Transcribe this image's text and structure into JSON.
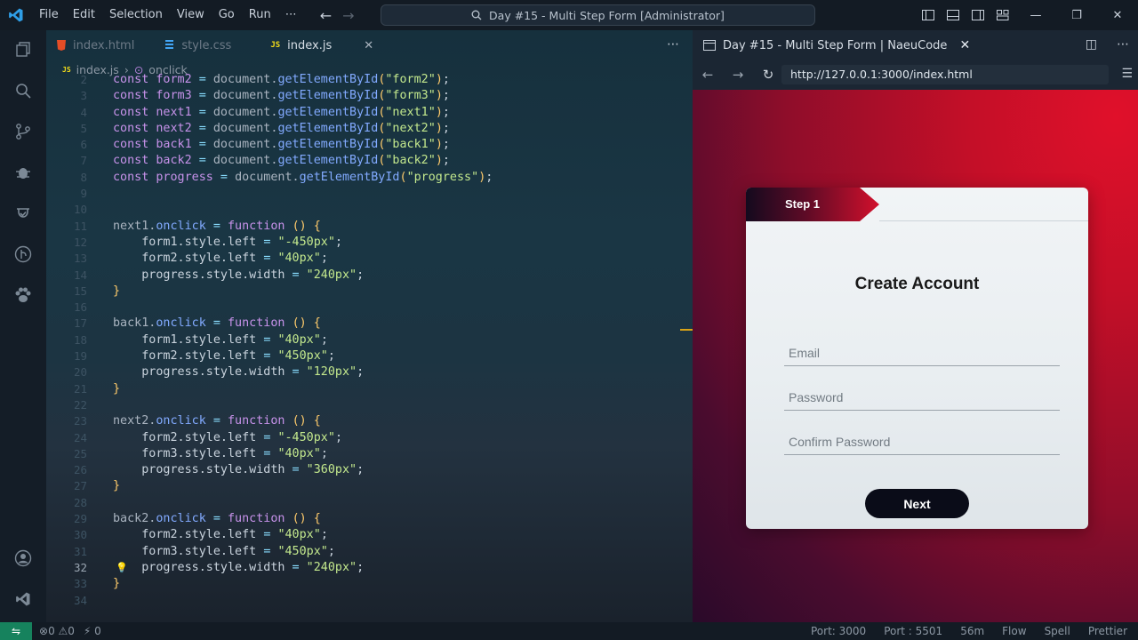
{
  "menu": [
    "File",
    "Edit",
    "Selection",
    "View",
    "Go",
    "Run",
    "⋯"
  ],
  "command_center": "Day #15 - Multi Step Form [Administrator]",
  "editor_tabs": [
    {
      "label": "index.html",
      "icon": "html-icon",
      "color": "#e44d26"
    },
    {
      "label": "style.css",
      "icon": "css-icon",
      "color": "#42a5f5"
    },
    {
      "label": "index.js",
      "icon": "js-icon",
      "color": "#f5de19",
      "active": true
    }
  ],
  "breadcrumb": {
    "file": "index.js",
    "symbol": "onclick"
  },
  "code_lines": [
    {
      "n": "2",
      "parts": [
        [
          "kw",
          "const "
        ],
        [
          "var",
          "form2"
        ],
        [
          "op",
          " = "
        ],
        [
          "obj",
          "document."
        ],
        [
          "fn",
          "getElementById"
        ],
        [
          "punc",
          "("
        ],
        [
          "str",
          "\"form2\""
        ],
        [
          "punc",
          ")"
        ],
        [
          "plain",
          ";"
        ]
      ]
    },
    {
      "n": "3",
      "parts": [
        [
          "kw",
          "const "
        ],
        [
          "var",
          "form3"
        ],
        [
          "op",
          " = "
        ],
        [
          "obj",
          "document."
        ],
        [
          "fn",
          "getElementById"
        ],
        [
          "punc",
          "("
        ],
        [
          "str",
          "\"form3\""
        ],
        [
          "punc",
          ")"
        ],
        [
          "plain",
          ";"
        ]
      ]
    },
    {
      "n": "4",
      "parts": [
        [
          "kw",
          "const "
        ],
        [
          "var",
          "next1"
        ],
        [
          "op",
          " = "
        ],
        [
          "obj",
          "document."
        ],
        [
          "fn",
          "getElementById"
        ],
        [
          "punc",
          "("
        ],
        [
          "str",
          "\"next1\""
        ],
        [
          "punc",
          ")"
        ],
        [
          "plain",
          ";"
        ]
      ]
    },
    {
      "n": "5",
      "parts": [
        [
          "kw",
          "const "
        ],
        [
          "var",
          "next2"
        ],
        [
          "op",
          " = "
        ],
        [
          "obj",
          "document."
        ],
        [
          "fn",
          "getElementById"
        ],
        [
          "punc",
          "("
        ],
        [
          "str",
          "\"next2\""
        ],
        [
          "punc",
          ")"
        ],
        [
          "plain",
          ";"
        ]
      ]
    },
    {
      "n": "6",
      "parts": [
        [
          "kw",
          "const "
        ],
        [
          "var",
          "back1"
        ],
        [
          "op",
          " = "
        ],
        [
          "obj",
          "document."
        ],
        [
          "fn",
          "getElementById"
        ],
        [
          "punc",
          "("
        ],
        [
          "str",
          "\"back1\""
        ],
        [
          "punc",
          ")"
        ],
        [
          "plain",
          ";"
        ]
      ]
    },
    {
      "n": "7",
      "parts": [
        [
          "kw",
          "const "
        ],
        [
          "var",
          "back2"
        ],
        [
          "op",
          " = "
        ],
        [
          "obj",
          "document."
        ],
        [
          "fn",
          "getElementById"
        ],
        [
          "punc",
          "("
        ],
        [
          "str",
          "\"back2\""
        ],
        [
          "punc",
          ")"
        ],
        [
          "plain",
          ";"
        ]
      ]
    },
    {
      "n": "8",
      "parts": [
        [
          "kw",
          "const "
        ],
        [
          "var",
          "progress"
        ],
        [
          "op",
          " = "
        ],
        [
          "obj",
          "document."
        ],
        [
          "fn",
          "getElementById"
        ],
        [
          "punc",
          "("
        ],
        [
          "str",
          "\"progress\""
        ],
        [
          "punc",
          ")"
        ],
        [
          "plain",
          ";"
        ]
      ]
    },
    {
      "n": "9",
      "parts": []
    },
    {
      "n": "10",
      "parts": []
    },
    {
      "n": "11",
      "parts": [
        [
          "obj",
          "next1."
        ],
        [
          "prop",
          "onclick"
        ],
        [
          "op",
          " = "
        ],
        [
          "kw",
          "function "
        ],
        [
          "punc",
          "() {"
        ]
      ]
    },
    {
      "n": "12",
      "parts": [
        [
          "plain",
          "    form1.style.left "
        ],
        [
          "op",
          "= "
        ],
        [
          "str",
          "\"-450px\""
        ],
        [
          "plain",
          ";"
        ]
      ]
    },
    {
      "n": "13",
      "parts": [
        [
          "plain",
          "    form2.style.left "
        ],
        [
          "op",
          "= "
        ],
        [
          "str",
          "\"40px\""
        ],
        [
          "plain",
          ";"
        ]
      ]
    },
    {
      "n": "14",
      "parts": [
        [
          "plain",
          "    progress.style.width "
        ],
        [
          "op",
          "= "
        ],
        [
          "str",
          "\"240px\""
        ],
        [
          "plain",
          ";"
        ]
      ]
    },
    {
      "n": "15",
      "parts": [
        [
          "punc",
          "}"
        ]
      ]
    },
    {
      "n": "16",
      "parts": []
    },
    {
      "n": "17",
      "parts": [
        [
          "obj",
          "back1."
        ],
        [
          "prop",
          "onclick"
        ],
        [
          "op",
          " = "
        ],
        [
          "kw",
          "function "
        ],
        [
          "punc",
          "() {"
        ]
      ]
    },
    {
      "n": "18",
      "parts": [
        [
          "plain",
          "    form1.style.left "
        ],
        [
          "op",
          "= "
        ],
        [
          "str",
          "\"40px\""
        ],
        [
          "plain",
          ";"
        ]
      ]
    },
    {
      "n": "19",
      "parts": [
        [
          "plain",
          "    form2.style.left "
        ],
        [
          "op",
          "= "
        ],
        [
          "str",
          "\"450px\""
        ],
        [
          "plain",
          ";"
        ]
      ]
    },
    {
      "n": "20",
      "parts": [
        [
          "plain",
          "    progress.style.width "
        ],
        [
          "op",
          "= "
        ],
        [
          "str",
          "\"120px\""
        ],
        [
          "plain",
          ";"
        ]
      ]
    },
    {
      "n": "21",
      "parts": [
        [
          "punc",
          "}"
        ]
      ]
    },
    {
      "n": "22",
      "parts": []
    },
    {
      "n": "23",
      "parts": [
        [
          "obj",
          "next2."
        ],
        [
          "prop",
          "onclick"
        ],
        [
          "op",
          " = "
        ],
        [
          "kw",
          "function "
        ],
        [
          "punc",
          "() {"
        ]
      ]
    },
    {
      "n": "24",
      "parts": [
        [
          "plain",
          "    form2.style.left "
        ],
        [
          "op",
          "= "
        ],
        [
          "str",
          "\"-450px\""
        ],
        [
          "plain",
          ";"
        ]
      ]
    },
    {
      "n": "25",
      "parts": [
        [
          "plain",
          "    form3.style.left "
        ],
        [
          "op",
          "= "
        ],
        [
          "str",
          "\"40px\""
        ],
        [
          "plain",
          ";"
        ]
      ]
    },
    {
      "n": "26",
      "parts": [
        [
          "plain",
          "    progress.style.width "
        ],
        [
          "op",
          "= "
        ],
        [
          "str",
          "\"360px\""
        ],
        [
          "plain",
          ";"
        ]
      ]
    },
    {
      "n": "27",
      "parts": [
        [
          "punc",
          "}"
        ]
      ]
    },
    {
      "n": "28",
      "parts": []
    },
    {
      "n": "29",
      "parts": [
        [
          "obj",
          "back2."
        ],
        [
          "prop",
          "onclick"
        ],
        [
          "op",
          " = "
        ],
        [
          "kw",
          "function "
        ],
        [
          "punc",
          "() {"
        ]
      ]
    },
    {
      "n": "30",
      "parts": [
        [
          "plain",
          "    form2.style.left "
        ],
        [
          "op",
          "= "
        ],
        [
          "str",
          "\"40px\""
        ],
        [
          "plain",
          ";"
        ]
      ]
    },
    {
      "n": "31",
      "parts": [
        [
          "plain",
          "    form3.style.left "
        ],
        [
          "op",
          "= "
        ],
        [
          "str",
          "\"450px\""
        ],
        [
          "plain",
          ";"
        ]
      ]
    },
    {
      "n": "32",
      "parts": [
        [
          "plain",
          "    progress.style.width "
        ],
        [
          "op",
          "= "
        ],
        [
          "str",
          "\"240px\""
        ],
        [
          "plain",
          ";"
        ]
      ],
      "current": true
    },
    {
      "n": "33",
      "parts": [
        [
          "punc",
          "}"
        ]
      ]
    },
    {
      "n": "34",
      "parts": []
    }
  ],
  "browser": {
    "tab_title": "Day #15 - Multi Step Form | NaeuCode",
    "url": "http://127.0.0.1:3000/index.html"
  },
  "form": {
    "step_label": "Step 1",
    "title": "Create Account",
    "email_placeholder": "Email",
    "password_placeholder": "Password",
    "confirm_placeholder": "Confirm Password",
    "next_label": "Next"
  },
  "status": {
    "errors": "0",
    "warnings": "0",
    "ports": "0",
    "port_text": "Port: 3000",
    "port2_text": "Port : 5501",
    "time": "56m",
    "flow": "Flow",
    "spell": "Spell",
    "prettier": "Prettier"
  },
  "colors": {
    "accent_red": "#d2102c",
    "status_remote": "#16825d"
  }
}
